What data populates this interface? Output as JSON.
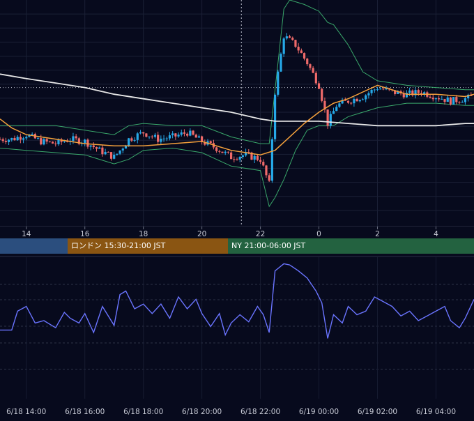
{
  "chart_data": [
    {
      "type": "line",
      "title": "",
      "kind": "candlestick with Bollinger Bands, moving averages",
      "x_tick_labels": [
        "14",
        "16",
        "18",
        "20",
        "22",
        "0",
        "2",
        "4"
      ],
      "x_ticks_hours": [
        14,
        16,
        18,
        20,
        22,
        24,
        26,
        28
      ],
      "x_range_hours": [
        13.1,
        29.3
      ],
      "y_range": [
        0,
        100
      ],
      "grid": true,
      "crosshair_hour": 21.35,
      "reference_level": 61,
      "colors": {
        "up": "#26a9e8",
        "down": "#ef6a6a",
        "band": "#3aa86b",
        "ma_short": "#f5a13c",
        "ma_long": "#e8e8e8"
      },
      "series": [
        {
          "key": "close",
          "values": [
            [
              13.1,
              38
            ],
            [
              13.5,
              38
            ],
            [
              14.0,
              40
            ],
            [
              14.5,
              37
            ],
            [
              15.0,
              36
            ],
            [
              15.5,
              38
            ],
            [
              16.0,
              37
            ],
            [
              16.5,
              33
            ],
            [
              17.0,
              30
            ],
            [
              17.2,
              33
            ],
            [
              17.5,
              38
            ],
            [
              18.0,
              41
            ],
            [
              18.5,
              38
            ],
            [
              19.0,
              39
            ],
            [
              19.5,
              41
            ],
            [
              20.0,
              37
            ],
            [
              20.5,
              34
            ],
            [
              21.0,
              30
            ],
            [
              21.5,
              31
            ],
            [
              22.0,
              29
            ],
            [
              22.3,
              18
            ],
            [
              22.5,
              59
            ],
            [
              22.8,
              84
            ],
            [
              23.2,
              80
            ],
            [
              23.6,
              72
            ],
            [
              24.0,
              62
            ],
            [
              24.3,
              45
            ],
            [
              24.6,
              53
            ],
            [
              25.0,
              55
            ],
            [
              25.5,
              57
            ],
            [
              26.0,
              61
            ],
            [
              26.5,
              59
            ],
            [
              27.0,
              58
            ],
            [
              27.5,
              59
            ],
            [
              28.0,
              57
            ],
            [
              28.5,
              55
            ],
            [
              29.0,
              56
            ],
            [
              29.3,
              57
            ]
          ]
        },
        {
          "key": "bb_upper",
          "values": [
            [
              13.1,
              44
            ],
            [
              14.0,
              44
            ],
            [
              15.0,
              44
            ],
            [
              16.0,
              42
            ],
            [
              17.0,
              40
            ],
            [
              17.5,
              44
            ],
            [
              18.0,
              45
            ],
            [
              19.0,
              44
            ],
            [
              20.0,
              44
            ],
            [
              21.0,
              39
            ],
            [
              22.0,
              36
            ],
            [
              22.3,
              36
            ],
            [
              22.5,
              60
            ],
            [
              22.8,
              96
            ],
            [
              23.0,
              100
            ],
            [
              23.5,
              98
            ],
            [
              24.0,
              95
            ],
            [
              24.3,
              90
            ],
            [
              24.5,
              89
            ],
            [
              25.0,
              80
            ],
            [
              25.5,
              68
            ],
            [
              26.0,
              64
            ],
            [
              27.0,
              62
            ],
            [
              28.0,
              61
            ],
            [
              29.0,
              60
            ],
            [
              29.3,
              60
            ]
          ]
        },
        {
          "key": "bb_lower",
          "values": [
            [
              13.1,
              34
            ],
            [
              14.0,
              33
            ],
            [
              15.0,
              32
            ],
            [
              16.0,
              31
            ],
            [
              17.0,
              27
            ],
            [
              17.5,
              29
            ],
            [
              18.0,
              33
            ],
            [
              19.0,
              34
            ],
            [
              20.0,
              32
            ],
            [
              21.0,
              26
            ],
            [
              22.0,
              24
            ],
            [
              22.3,
              8
            ],
            [
              22.5,
              12
            ],
            [
              22.8,
              20
            ],
            [
              23.2,
              33
            ],
            [
              23.6,
              42
            ],
            [
              24.0,
              44
            ],
            [
              24.5,
              44
            ],
            [
              25.0,
              48
            ],
            [
              26.0,
              52
            ],
            [
              27.0,
              54
            ],
            [
              28.0,
              54
            ],
            [
              29.0,
              53
            ],
            [
              29.3,
              53
            ]
          ]
        },
        {
          "key": "ma_short",
          "values": [
            [
              13.1,
              47
            ],
            [
              13.5,
              43
            ],
            [
              14.0,
              40
            ],
            [
              15.0,
              38
            ],
            [
              16.0,
              36
            ],
            [
              17.0,
              35
            ],
            [
              18.0,
              35
            ],
            [
              19.0,
              36
            ],
            [
              20.0,
              37
            ],
            [
              21.0,
              33
            ],
            [
              22.0,
              31
            ],
            [
              22.5,
              33
            ],
            [
              23.0,
              39
            ],
            [
              23.5,
              45
            ],
            [
              24.0,
              50
            ],
            [
              24.5,
              54
            ],
            [
              25.0,
              56
            ],
            [
              25.5,
              59
            ],
            [
              26.0,
              62
            ],
            [
              26.5,
              60
            ],
            [
              27.0,
              58
            ],
            [
              28.0,
              58
            ],
            [
              29.0,
              57
            ],
            [
              29.3,
              58
            ]
          ]
        },
        {
          "key": "ma_long",
          "values": [
            [
              13.1,
              67
            ],
            [
              14.0,
              65
            ],
            [
              15.0,
              63
            ],
            [
              16.0,
              61
            ],
            [
              17.0,
              58
            ],
            [
              18.0,
              56
            ],
            [
              19.0,
              54
            ],
            [
              20.0,
              52
            ],
            [
              21.0,
              50
            ],
            [
              22.0,
              47
            ],
            [
              22.5,
              46
            ],
            [
              23.0,
              46
            ],
            [
              24.0,
              46
            ],
            [
              25.0,
              45
            ],
            [
              26.0,
              44
            ],
            [
              27.0,
              44
            ],
            [
              28.0,
              44
            ],
            [
              29.0,
              45
            ],
            [
              29.3,
              45
            ]
          ]
        }
      ]
    },
    {
      "type": "line",
      "title": "",
      "kind": "oscillator",
      "x_tick_labels": [
        "6/18 14:00",
        "6/18 16:00",
        "6/18 18:00",
        "6/18 20:00",
        "6/18 22:00",
        "6/19 00:00",
        "6/19 02:00",
        "6/19 04:00"
      ],
      "x_ticks_hours": [
        14,
        16,
        18,
        20,
        22,
        24,
        26,
        28
      ],
      "x_range_hours": [
        13.1,
        29.3
      ],
      "y_range": [
        0,
        100
      ],
      "grid": true,
      "color": "#6a74ff",
      "series": [
        {
          "key": "oscillator",
          "values": [
            [
              13.1,
              42
            ],
            [
              13.5,
              42
            ],
            [
              13.7,
              58
            ],
            [
              14.0,
              62
            ],
            [
              14.3,
              48
            ],
            [
              14.6,
              50
            ],
            [
              15.0,
              44
            ],
            [
              15.3,
              57
            ],
            [
              15.5,
              52
            ],
            [
              15.8,
              48
            ],
            [
              16.0,
              56
            ],
            [
              16.3,
              40
            ],
            [
              16.6,
              62
            ],
            [
              17.0,
              46
            ],
            [
              17.2,
              72
            ],
            [
              17.4,
              75
            ],
            [
              17.7,
              60
            ],
            [
              18.0,
              64
            ],
            [
              18.3,
              56
            ],
            [
              18.6,
              64
            ],
            [
              18.9,
              52
            ],
            [
              19.2,
              70
            ],
            [
              19.5,
              60
            ],
            [
              19.8,
              68
            ],
            [
              20.0,
              56
            ],
            [
              20.3,
              45
            ],
            [
              20.6,
              56
            ],
            [
              20.8,
              38
            ],
            [
              21.0,
              48
            ],
            [
              21.3,
              55
            ],
            [
              21.6,
              49
            ],
            [
              21.9,
              62
            ],
            [
              22.1,
              55
            ],
            [
              22.3,
              40
            ],
            [
              22.5,
              92
            ],
            [
              22.8,
              98
            ],
            [
              23.0,
              97
            ],
            [
              23.3,
              92
            ],
            [
              23.6,
              86
            ],
            [
              23.9,
              75
            ],
            [
              24.1,
              65
            ],
            [
              24.3,
              35
            ],
            [
              24.5,
              55
            ],
            [
              24.8,
              48
            ],
            [
              25.0,
              62
            ],
            [
              25.3,
              55
            ],
            [
              25.6,
              58
            ],
            [
              25.9,
              70
            ],
            [
              26.2,
              66
            ],
            [
              26.5,
              62
            ],
            [
              26.8,
              54
            ],
            [
              27.1,
              58
            ],
            [
              27.4,
              50
            ],
            [
              27.7,
              54
            ],
            [
              28.0,
              58
            ],
            [
              28.3,
              62
            ],
            [
              28.5,
              50
            ],
            [
              28.8,
              44
            ],
            [
              29.0,
              52
            ],
            [
              29.3,
              68
            ]
          ]
        }
      ]
    }
  ],
  "sessions": [
    {
      "label": "",
      "color": "#2b4e7e"
    },
    {
      "label": "ロンドン 15:30-21:00 JST",
      "color": "#8a5512"
    },
    {
      "label": "NY 21:00-06:00 JST",
      "color": "#236240"
    }
  ]
}
